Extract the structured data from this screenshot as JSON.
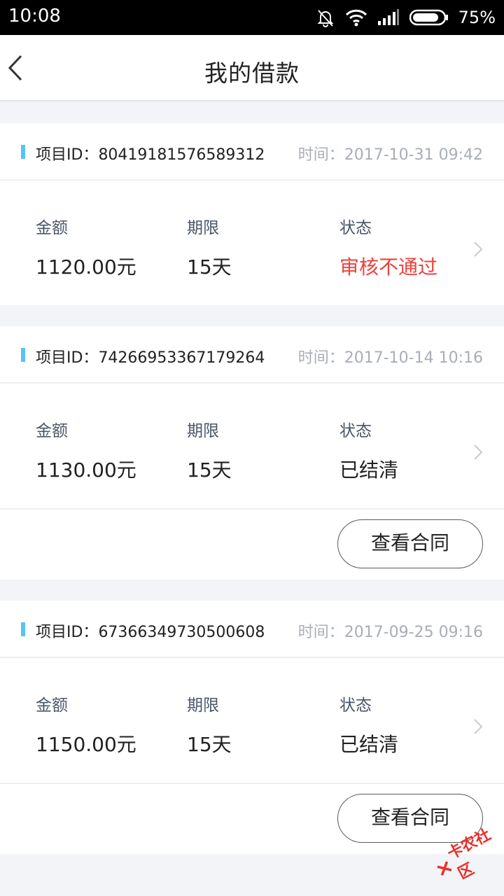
{
  "status_bar": {
    "time": "10:08",
    "battery": "75%"
  },
  "header": {
    "title": "我的借款"
  },
  "labels": {
    "id_prefix": "项目ID：",
    "time_prefix": "时间：",
    "amount": "金额",
    "term": "期限",
    "status": "状态",
    "contract_button": "查看合同"
  },
  "loans": [
    {
      "id": "80419181576589312",
      "time": "2017-10-31 09:42",
      "amount": "1120.00元",
      "term": "15天",
      "status": "审核不通过",
      "has_contract": false
    },
    {
      "id": "74266953367179264",
      "time": "2017-10-14 10:16",
      "amount": "1130.00元",
      "term": "15天",
      "status": "已结清",
      "has_contract": true
    },
    {
      "id": "67366349730500608",
      "time": "2017-09-25 09:16",
      "amount": "1150.00元",
      "term": "15天",
      "status": "已结清",
      "has_contract": true
    }
  ],
  "colors": {
    "accent_bar": "#55c3f7",
    "status_rejected": "#f0403b",
    "status_default": "#222222"
  },
  "watermark": "卡农社区"
}
